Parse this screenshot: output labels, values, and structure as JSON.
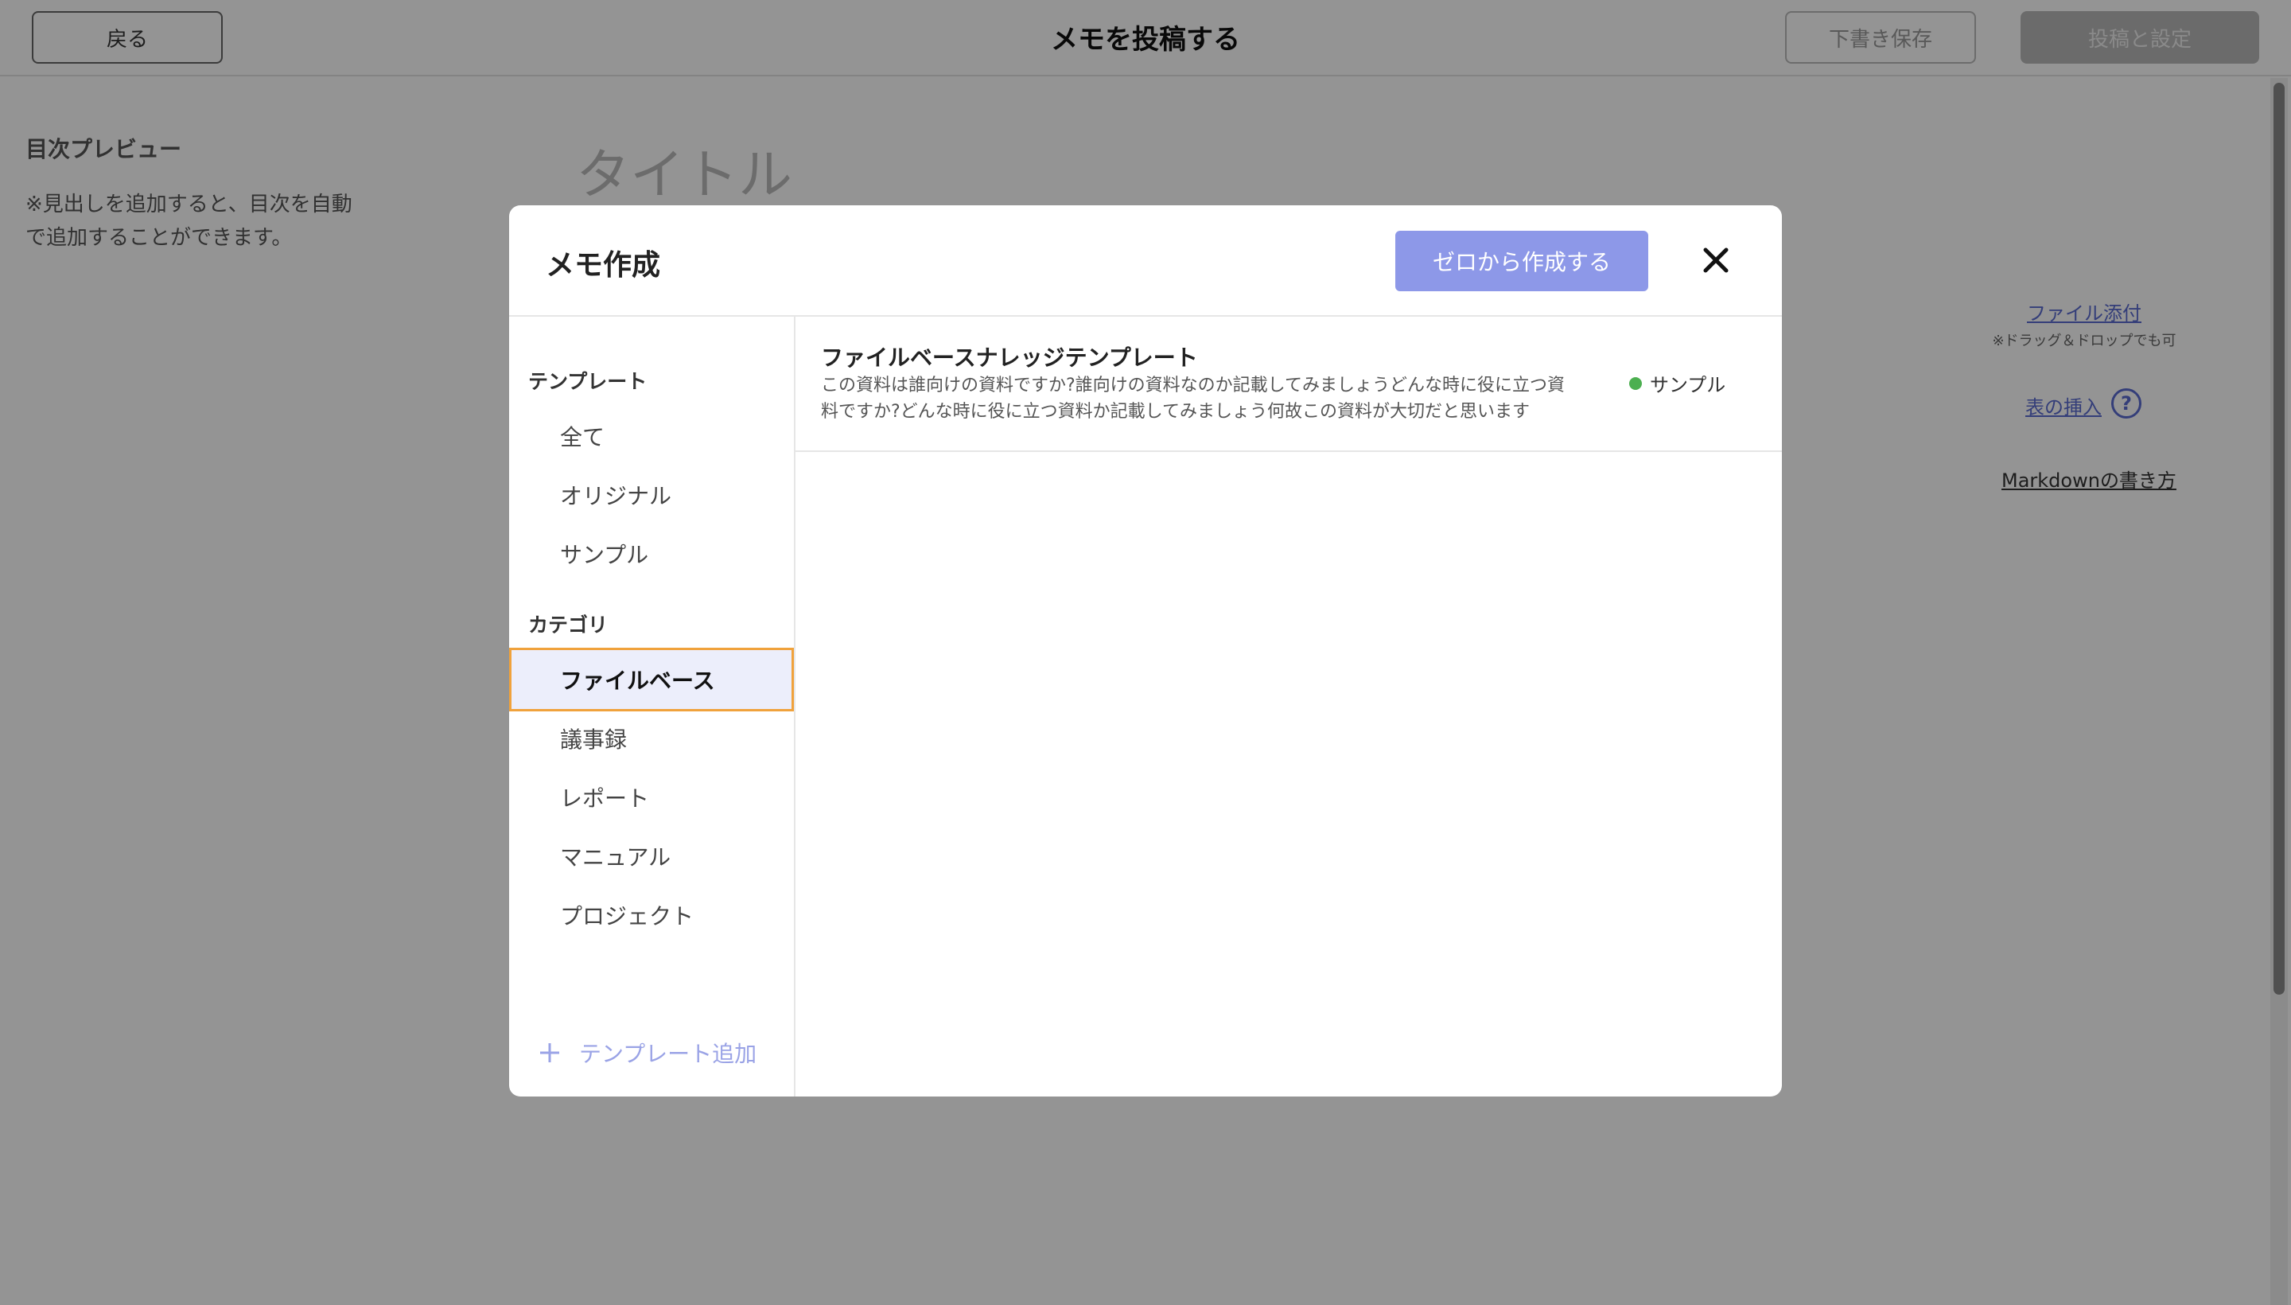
{
  "header": {
    "back_label": "戻る",
    "title": "メモを投稿する",
    "draft_label": "下書き保存",
    "post_label": "投稿と設定"
  },
  "editor": {
    "toc_title": "目次プレビュー",
    "toc_note": "※見出しを追加すると、目次を自動で追加することができます。",
    "title_placeholder": "タイトル",
    "file_attach": "ファイル添付",
    "drag_note": "※ドラッグ＆ドロップでも可",
    "table_insert": "表の挿入",
    "help_icon": "?",
    "markdown_link": "Markdownの書き方"
  },
  "modal": {
    "title": "メモ作成",
    "create_from_scratch": "ゼロから作成する",
    "sections": {
      "template_label": "テンプレート",
      "category_label": "カテゴリ"
    },
    "template_items": [
      {
        "label": "全て"
      },
      {
        "label": "オリジナル"
      },
      {
        "label": "サンプル"
      }
    ],
    "category_items": [
      {
        "label": "ファイルベース",
        "selected": true
      },
      {
        "label": "議事録"
      },
      {
        "label": "レポート"
      },
      {
        "label": "マニュアル"
      },
      {
        "label": "プロジェクト"
      }
    ],
    "add_template": "テンプレート追加",
    "templates": [
      {
        "name": "ファイルベースナレッジテンプレート",
        "description": "この資料は誰向けの資料ですか?誰向けの資料なのか記載してみましょうどんな時に役に立つ資料ですか?どんな時に役に立つ資料か記載してみましょう何故この資料が大切だと思います",
        "badge": "サンプル"
      }
    ]
  },
  "colors": {
    "accent": "#8d98e8",
    "link": "#5a6bd1",
    "selected_border": "#f0a23c",
    "selected_bg": "#eceefb",
    "badge_dot": "#4caf50"
  }
}
